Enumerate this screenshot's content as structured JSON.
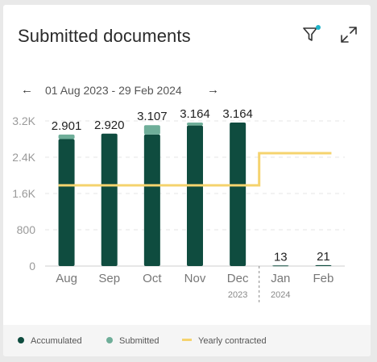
{
  "card": {
    "title": "Submitted documents"
  },
  "icons": {
    "filter": "filter-icon",
    "expand": "expand-icon"
  },
  "date_range": {
    "prev_label": "←",
    "text": "01 Aug 2023 - 29 Feb 2024",
    "next_label": "→"
  },
  "colors": {
    "accumulated": "#0f4c3f",
    "submitted": "#6fae99",
    "yearly_contracted": "#f5d36e",
    "filter_badge": "#1fb3c9"
  },
  "legend": [
    {
      "label": "Accumulated",
      "kind": "dot",
      "color": "#0f4c3f"
    },
    {
      "label": "Submitted",
      "kind": "dot",
      "color": "#6fae99"
    },
    {
      "label": "Yearly contracted",
      "kind": "line",
      "color": "#f5d36e"
    }
  ],
  "chart_data": {
    "type": "bar",
    "categories": [
      "Aug",
      "Sep",
      "Oct",
      "Nov",
      "Dec",
      "Jan",
      "Feb"
    ],
    "year_labels": {
      "Dec": "2023",
      "Jan": "2024"
    },
    "series": [
      {
        "name": "Accumulated",
        "values": [
          2800,
          2920,
          2900,
          3100,
          3164,
          13,
          21
        ]
      },
      {
        "name": "Submitted",
        "values": [
          101,
          0,
          207,
          64,
          0,
          0,
          0
        ]
      },
      {
        "name": "Yearly contracted",
        "values": [
          1780,
          1780,
          1780,
          1780,
          1780,
          2490,
          2490
        ]
      }
    ],
    "data_labels": [
      "2.901",
      "2.920",
      "3.107",
      "3.164",
      "3.164",
      "13",
      "21"
    ],
    "y_ticks": [
      "0",
      "800",
      "1.6K",
      "2.4K",
      "3.2K"
    ],
    "y_tick_values": [
      0,
      800,
      1600,
      2400,
      3200
    ],
    "ylim": [
      0,
      3200
    ],
    "grid": true
  }
}
